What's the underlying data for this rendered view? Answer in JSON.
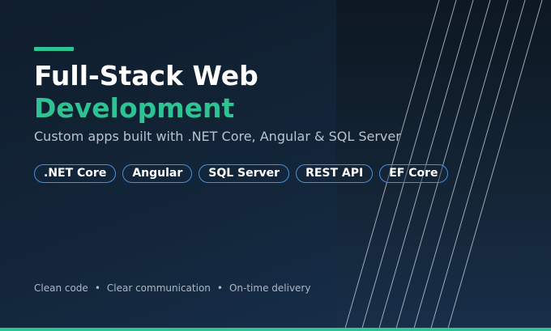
{
  "hero": {
    "title_line1": "Full-Stack Web",
    "title_line2": "Development",
    "subtitle": "Custom apps built with .NET Core, Angular & SQL Server"
  },
  "tags": [
    ".NET Core",
    "Angular",
    "SQL Server",
    "REST API",
    "EF Core"
  ],
  "footer": {
    "items": [
      "Clean code",
      "Clear communication",
      "On-time delivery"
    ],
    "separator": "•"
  },
  "colors": {
    "accent": "#2ec393",
    "tag_border": "#4a8fd8",
    "background_dark": "#0f1d2c",
    "background_light": "#183150"
  }
}
